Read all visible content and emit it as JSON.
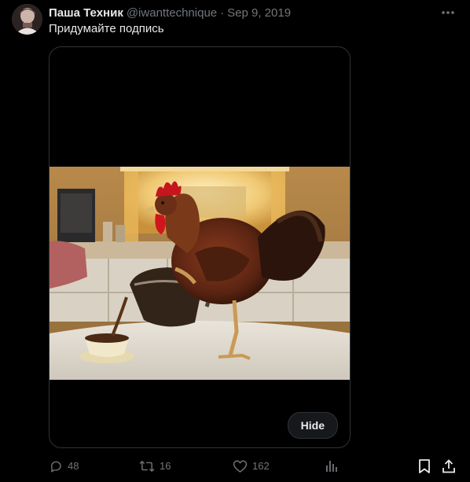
{
  "tweet": {
    "display_name": "Паша Техник",
    "handle": "@iwanttechnique",
    "separator": "·",
    "date": "Sep 9, 2019",
    "text": "Придумайте подпись",
    "media": {
      "hide_label": "Hide"
    },
    "actions": {
      "replies": "48",
      "retweets": "16",
      "likes": "162"
    }
  },
  "icons": {
    "more": "more-horizontal-icon",
    "reply": "reply-icon",
    "retweet": "retweet-icon",
    "like": "heart-icon",
    "views": "analytics-icon",
    "bookmark": "bookmark-icon",
    "share": "share-icon"
  },
  "colors": {
    "background": "#000000",
    "text_primary": "#e7e9ea",
    "text_secondary": "#71767b",
    "border": "#2f3336"
  }
}
